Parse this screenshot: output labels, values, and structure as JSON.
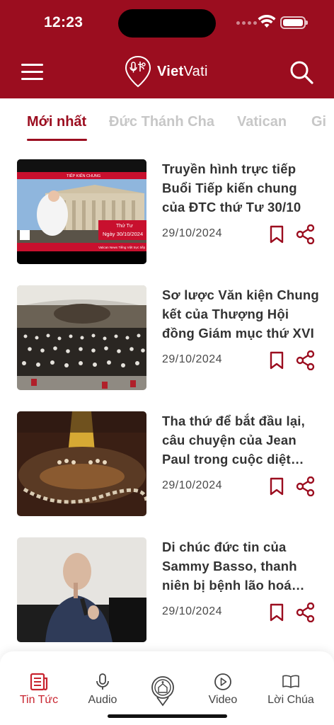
{
  "status_bar": {
    "time": "12:23"
  },
  "header": {
    "logo_bold": "Viet",
    "logo_light": "Vati",
    "brand_color": "#9b0d1f",
    "menu_icon": "hamburger-icon",
    "search_icon": "search-icon"
  },
  "tabs": [
    {
      "label": "Mới nhất",
      "active": true
    },
    {
      "label": "Đức Thánh Cha",
      "active": false
    },
    {
      "label": "Vatican",
      "active": false
    },
    {
      "label": "Gi",
      "active": false
    }
  ],
  "articles": [
    {
      "title": "Truyền hình trực tiếp Buổi Tiếp kiến chung của ĐTC thứ Tư 30/10",
      "date": "29/10/2024",
      "thumb_banner": "TIẾP KIẾN CHUNG",
      "thumb_day": "Thứ Tư",
      "thumb_date": "Ngày 30/10/2024",
      "thumb_footer": "Vatican News Tiếng Việt trực tiếp"
    },
    {
      "title": "Sơ lược Văn kiện Chung kết của Thượng Hội đồng Giám mục thứ XVI",
      "date": "29/10/2024"
    },
    {
      "title": "Tha thứ để bắt đầu lại, câu chuyện của Jean Paul trong cuộc diệt chủng",
      "date": "29/10/2024"
    },
    {
      "title": "Di chúc đức tin của Sammy Basso, thanh niên bị bệnh lão hoá sớm",
      "date": "29/10/2024"
    }
  ],
  "bottom_nav": [
    {
      "label": "Tin Tức",
      "icon": "news-icon",
      "active": true
    },
    {
      "label": "Audio",
      "icon": "microphone-icon",
      "active": false
    },
    {
      "label": "",
      "icon": "church-location-icon",
      "active": false
    },
    {
      "label": "Video",
      "icon": "play-circle-icon",
      "active": false
    },
    {
      "label": "Lời Chúa",
      "icon": "book-icon",
      "active": false
    }
  ],
  "colors": {
    "accent": "#9b0d1f",
    "active_nav": "#c8242f",
    "inactive_tab": "#c7c7c7"
  }
}
